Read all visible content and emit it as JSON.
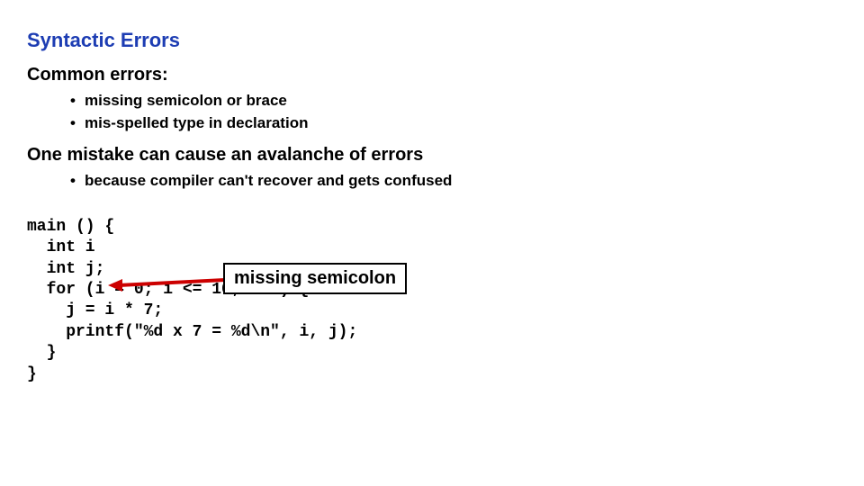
{
  "title": "Syntactic Errors",
  "subhead1": "Common errors:",
  "bullets1": [
    "missing semicolon or brace",
    "mis-spelled type in declaration"
  ],
  "subhead2": "One mistake can cause an avalanche of errors",
  "bullets2": [
    "because compiler can't recover and gets confused"
  ],
  "code": "main () {\n  int i\n  int j;\n  for (i = 0; i <= 10; i++) {\n    j = i * 7;\n    printf(\"%d x 7 = %d\\n\", i, j);\n  }\n}",
  "callout": "missing semicolon"
}
